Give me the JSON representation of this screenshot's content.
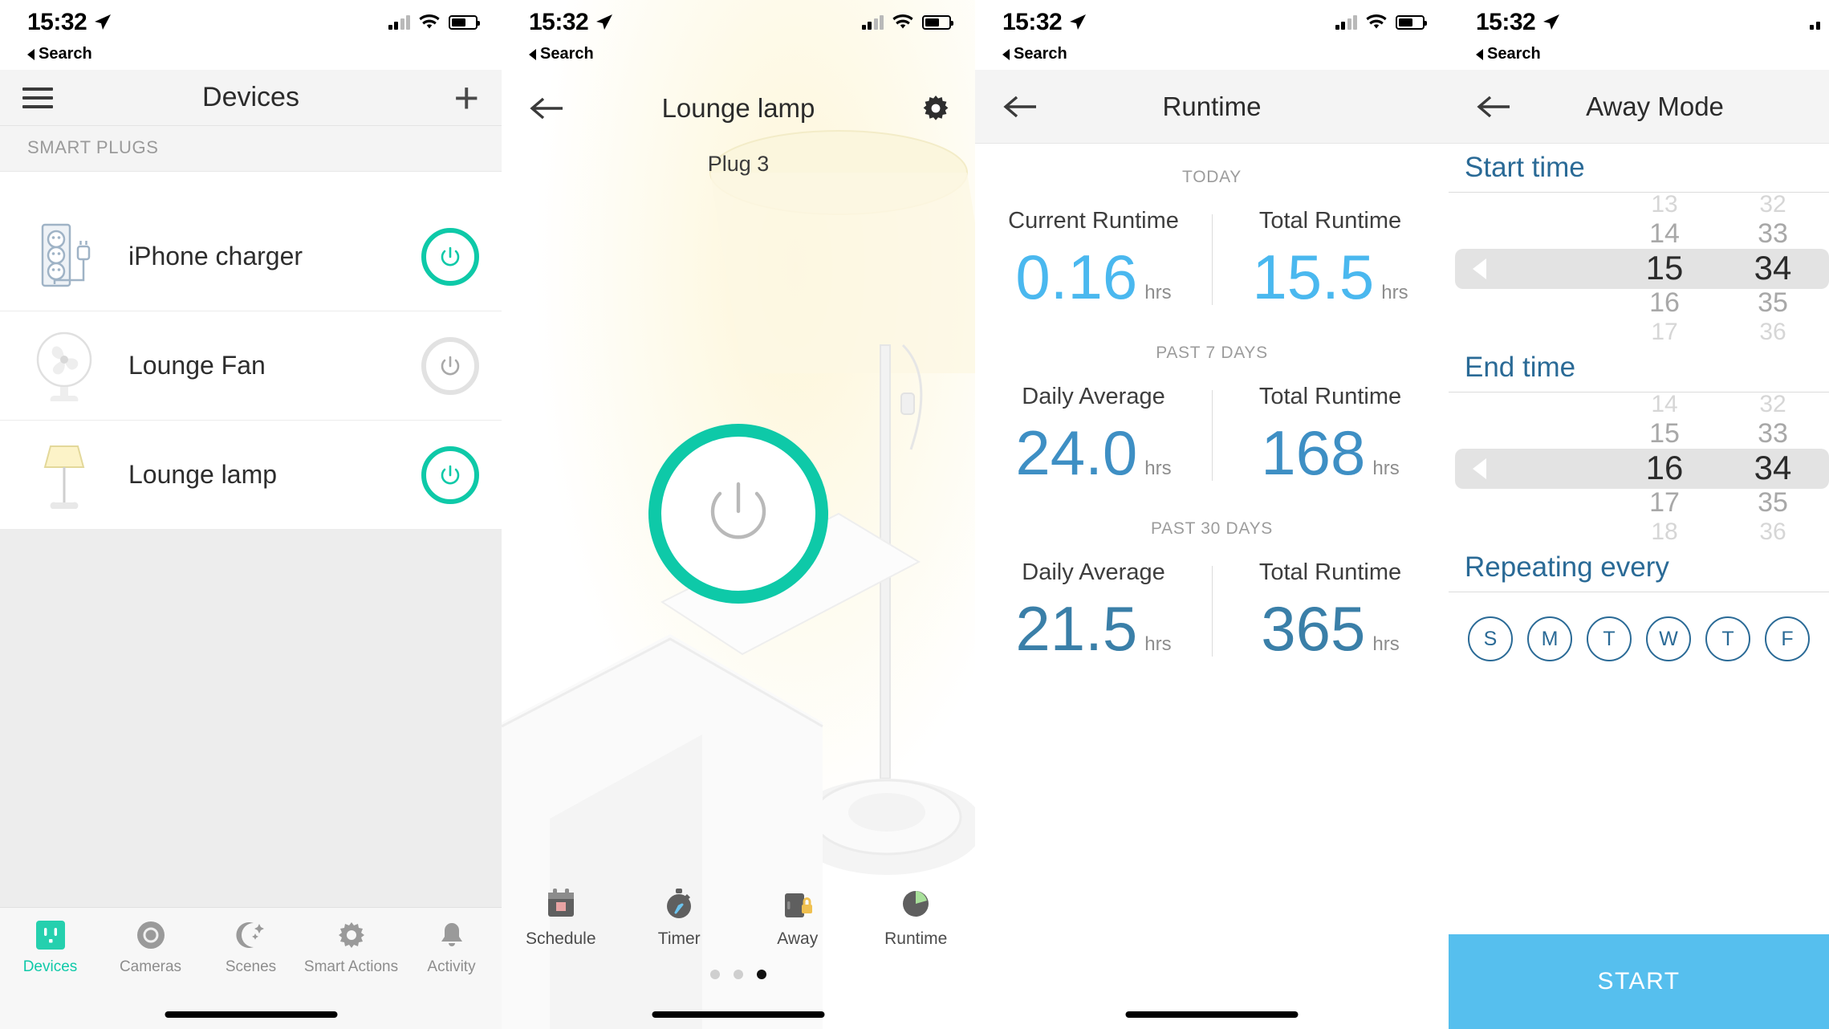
{
  "status_bar": {
    "time": "15:32",
    "back_label": "Search",
    "location_icon": "location-arrow-icon",
    "signal_icon": "cellular-signal-icon",
    "wifi_icon": "wifi-icon",
    "battery_icon": "battery-icon"
  },
  "theme": {
    "accent_teal": "#0ec9a8",
    "accent_blue_light": "#4ab8ef",
    "accent_blue_dark": "#3a7fa8",
    "link_blue": "#2a6a96",
    "start_button": "#56bfee"
  },
  "devices_screen": {
    "title": "Devices",
    "menu_icon": "hamburger-menu-icon",
    "add_icon": "plus-icon",
    "section_label": "SMART PLUGS",
    "devices": [
      {
        "name": "iPhone charger",
        "icon": "power-strip-icon",
        "power": "on"
      },
      {
        "name": "Lounge Fan",
        "icon": "fan-icon",
        "power": "off"
      },
      {
        "name": "Lounge lamp",
        "icon": "floor-lamp-icon",
        "power": "on"
      }
    ],
    "tabs": [
      {
        "label": "Devices",
        "icon": "outlet-icon",
        "active": true
      },
      {
        "label": "Cameras",
        "icon": "camera-icon",
        "active": false
      },
      {
        "label": "Scenes",
        "icon": "moon-stars-icon",
        "active": false
      },
      {
        "label": "Smart Actions",
        "icon": "gear-sparkle-icon",
        "active": false
      },
      {
        "label": "Activity",
        "icon": "bell-icon",
        "active": false
      }
    ]
  },
  "device_screen": {
    "title": "Lounge lamp",
    "subtitle": "Plug 3",
    "back_icon": "arrow-left-icon",
    "settings_icon": "gear-icon",
    "power_icon": "power-icon",
    "power_state": "on",
    "tabs": [
      {
        "label": "Schedule",
        "icon": "calendar-icon"
      },
      {
        "label": "Timer",
        "icon": "stopwatch-icon"
      },
      {
        "label": "Away",
        "icon": "suitcase-lock-icon"
      },
      {
        "label": "Runtime",
        "icon": "pie-chart-icon"
      }
    ],
    "page_dots": {
      "count": 3,
      "active_index": 2
    }
  },
  "runtime_screen": {
    "title": "Runtime",
    "back_icon": "arrow-left-icon",
    "unit": "hrs",
    "groups": [
      {
        "header": "TODAY",
        "color": "#4ab8ef",
        "items": [
          {
            "label": "Current Runtime",
            "value": "0.16"
          },
          {
            "label": "Total Runtime",
            "value": "15.5"
          }
        ]
      },
      {
        "header": "PAST 7 DAYS",
        "color": "#3e8fc4",
        "items": [
          {
            "label": "Daily Average",
            "value": "24.0"
          },
          {
            "label": "Total Runtime",
            "value": "168"
          }
        ]
      },
      {
        "header": "PAST 30 DAYS",
        "color": "#3a7fa8",
        "items": [
          {
            "label": "Daily Average",
            "value": "21.5"
          },
          {
            "label": "Total Runtime",
            "value": "365"
          }
        ]
      }
    ]
  },
  "away_screen": {
    "title": "Away Mode",
    "back_icon": "arrow-left-icon",
    "start_time": {
      "label": "Start time",
      "hours": [
        "13",
        "14",
        "15",
        "16",
        "17"
      ],
      "minutes": [
        "32",
        "33",
        "34",
        "35",
        "36"
      ],
      "selected_hour": "15",
      "selected_minute": "34"
    },
    "end_time": {
      "label": "End time",
      "hours": [
        "14",
        "15",
        "16",
        "17",
        "18"
      ],
      "minutes": [
        "32",
        "33",
        "34",
        "35",
        "36"
      ],
      "selected_hour": "16",
      "selected_minute": "34"
    },
    "repeat": {
      "label": "Repeating every",
      "days": [
        "S",
        "M",
        "T",
        "W",
        "T",
        "F"
      ]
    },
    "start_button": "START"
  }
}
